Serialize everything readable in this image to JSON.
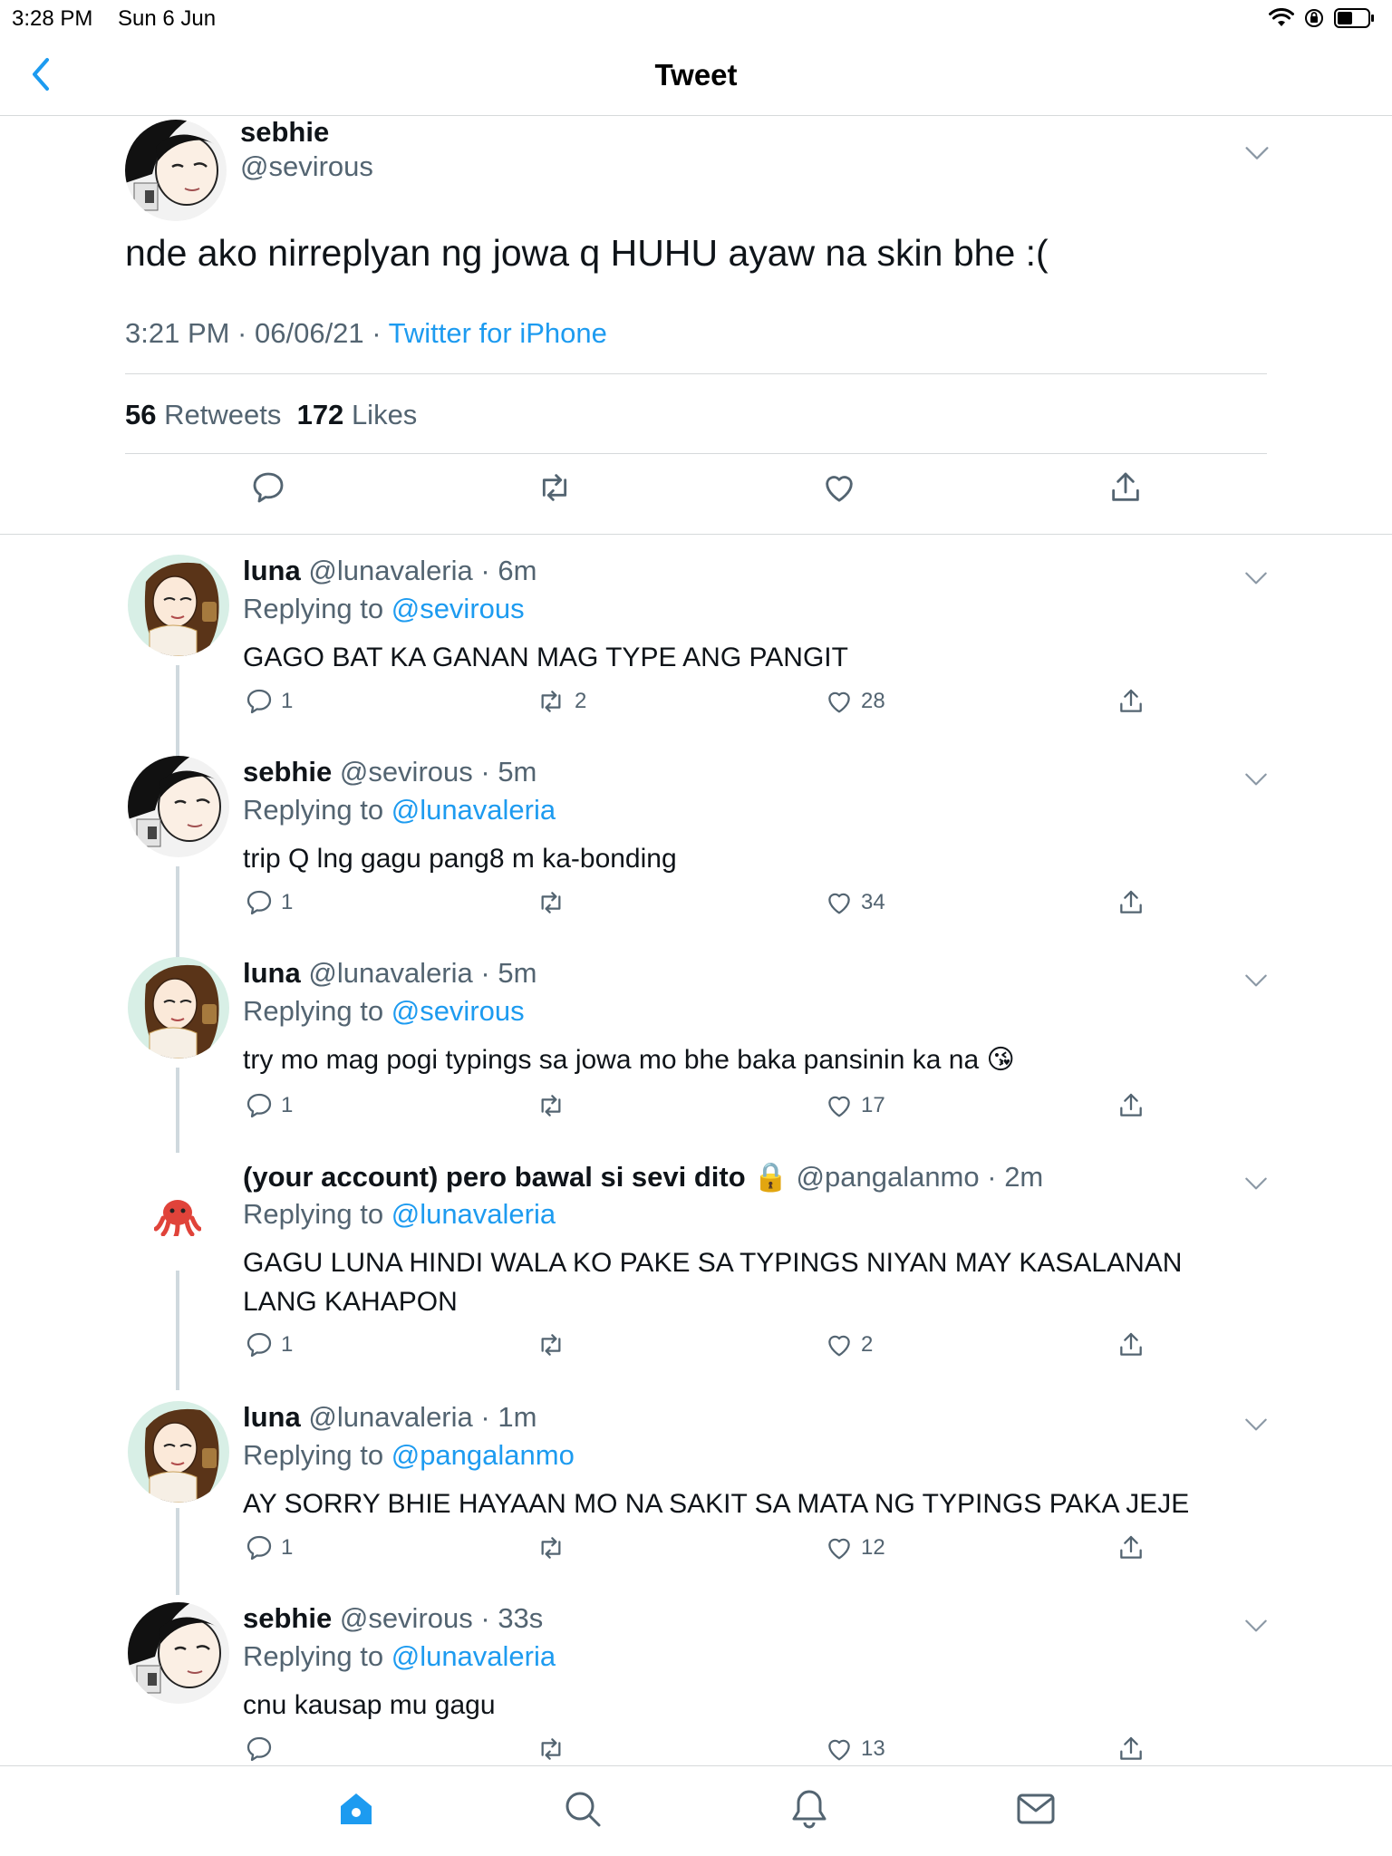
{
  "status_bar": {
    "time": "3:28 PM",
    "date": "Sun 6 Jun"
  },
  "nav": {
    "title": "Tweet"
  },
  "main_tweet": {
    "name": "sebhie",
    "handle": "@sevirous",
    "text": "nde ako nirreplyan ng jowa q HUHU ayaw na skin bhe :(",
    "time": "3:21 PM · 06/06/21 · ",
    "source": "Twitter for iPhone",
    "retweets_count": "56",
    "retweets_label": "Retweets",
    "likes_count": "172",
    "likes_label": "Likes"
  },
  "replies": [
    {
      "name": "luna",
      "handle": "@lunavaleria",
      "sep": " · ",
      "time": "6m",
      "replying_label": "Replying to ",
      "mention": "@sevirous",
      "text": "GAGO BAT KA GANAN MAG TYPE ANG PANGIT",
      "replies": "1",
      "retweets": "2",
      "likes": "28"
    },
    {
      "name": "sebhie",
      "handle": "@sevirous",
      "sep": " · ",
      "time": "5m",
      "replying_label": "Replying to ",
      "mention": "@lunavaleria",
      "text": "trip Q lng gagu pang8 m ka-bonding",
      "replies": "1",
      "retweets": "",
      "likes": "34"
    },
    {
      "name": "luna",
      "handle": "@lunavaleria",
      "sep": " · ",
      "time": "5m",
      "replying_label": "Replying to ",
      "mention": "@sevirous",
      "text": "try mo mag pogi typings sa jowa mo bhe baka pansinin ka na 😘",
      "replies": "1",
      "retweets": "",
      "likes": "17"
    },
    {
      "name": "(your account) pero bawal si sevi dito 🔒",
      "handle": "@pangalanmo",
      "sep": " · ",
      "time": "2m",
      "replying_label": "Replying to ",
      "mention": "@lunavaleria",
      "text": "GAGU LUNA HINDI WALA KO PAKE SA TYPINGS NIYAN MAY KASALANAN LANG KAHAPON",
      "replies": "1",
      "retweets": "",
      "likes": "2"
    },
    {
      "name": "luna",
      "handle": "@lunavaleria",
      "sep": " · ",
      "time": "1m",
      "replying_label": "Replying to ",
      "mention": "@pangalanmo",
      "text": "AY SORRY BHIE HAYAAN MO NA SAKIT SA MATA NG TYPINGS PAKA JEJE",
      "replies": "1",
      "retweets": "",
      "likes": "12"
    },
    {
      "name": "sebhie",
      "handle": "@sevirous",
      "sep": " · ",
      "time": "33s",
      "replying_label": "Replying to ",
      "mention": "@lunavaleria",
      "text": "cnu kausap mu gagu",
      "replies": "",
      "retweets": "",
      "likes": "13"
    }
  ],
  "colors": {
    "accent": "#1d9bf0",
    "muted": "#536471",
    "text": "#0f1419",
    "divider": "#d6d9db"
  },
  "icons": [
    "back-chevron-icon",
    "chevron-down-icon",
    "reply-icon",
    "retweet-icon",
    "like-icon",
    "share-icon",
    "home-icon",
    "search-icon",
    "notifications-icon",
    "messages-icon",
    "wifi-icon",
    "battery-icon"
  ]
}
